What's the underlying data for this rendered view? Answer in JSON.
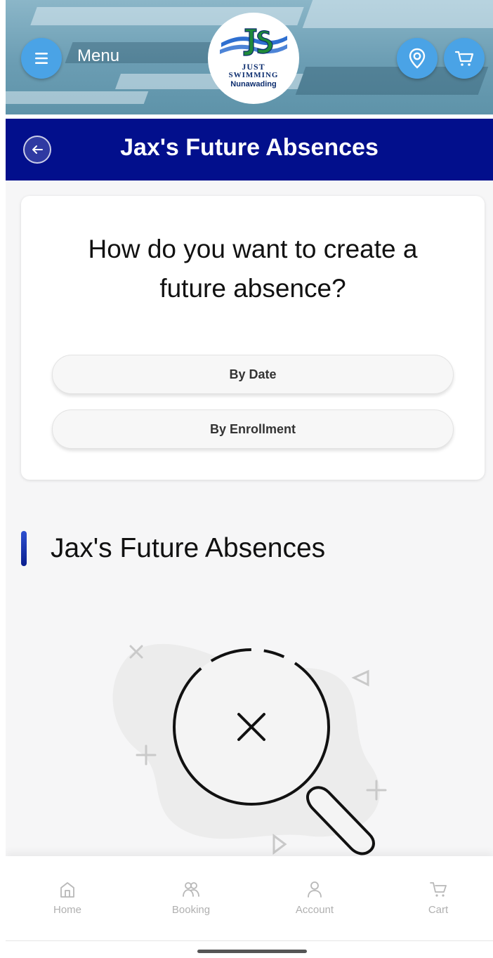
{
  "header": {
    "menu_label": "Menu",
    "logo": {
      "line1": "JUST",
      "line2": "SWIMMING",
      "line3": "Nunawading"
    },
    "icons": {
      "menu": "hamburger-icon",
      "location": "location-pin-icon",
      "cart": "cart-icon"
    }
  },
  "title_bar": {
    "title": "Jax's Future Absences",
    "back_icon": "arrow-left-icon"
  },
  "card": {
    "heading_line1": "How do you want to create a",
    "heading_line2": "future absence?",
    "options": [
      "By Date",
      "By Enrollment"
    ]
  },
  "section": {
    "title": "Jax's Future Absences"
  },
  "empty_state": {
    "icon": "magnifier-no-results-icon"
  },
  "tabbar": {
    "items": [
      {
        "label": "Home",
        "icon": "home-icon"
      },
      {
        "label": "Booking",
        "icon": "people-icon"
      },
      {
        "label": "Account",
        "icon": "person-icon"
      },
      {
        "label": "Cart",
        "icon": "cart-icon"
      }
    ]
  },
  "colors": {
    "primary": "#020f8c",
    "accent": "#4aa3e6",
    "background": "#f6f6f7"
  }
}
